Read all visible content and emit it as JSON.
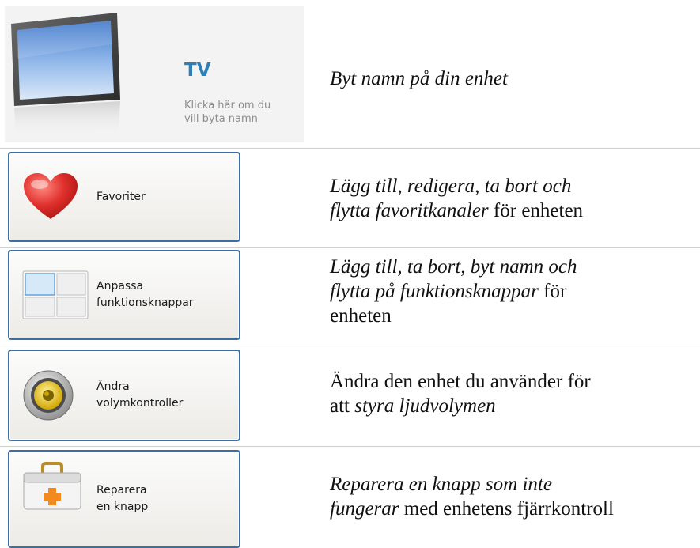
{
  "device": {
    "name": "TV",
    "hint_line1": "Klicka här om du",
    "hint_line2": "vill byta namn",
    "description": "Byt namn på din enhet"
  },
  "buttons": [
    {
      "icon": "heart-icon",
      "label_lines": [
        "Favoriter"
      ],
      "desc_italic_1": "Lägg till, redigera, ta bort och",
      "desc_italic_2": "flytta favoritkanaler",
      "desc_plain_2": " för enheten"
    },
    {
      "icon": "button-grid-icon",
      "label_lines": [
        "Anpassa",
        "funktionsknappar"
      ],
      "desc_italic_1": "Lägg till, ta bort, byt namn och",
      "desc_italic_2": "flytta på funktionsknappar",
      "desc_plain_2": " för",
      "desc_plain_3": "enheten"
    },
    {
      "icon": "speaker-icon",
      "label_lines": [
        "Ändra",
        "volymkontroller"
      ],
      "desc_plain_1": "Ändra den enhet du använder för",
      "desc_plain_2a": "att ",
      "desc_italic_2": "styra ljudvolymen"
    },
    {
      "icon": "first-aid-kit-icon",
      "label_lines": [
        "Reparera",
        "en knapp"
      ],
      "desc_italic_1": "Reparera en knapp som inte",
      "desc_italic_2": "fungerar",
      "desc_plain_2": " med enhetens fjärrkontroll"
    }
  ],
  "colors": {
    "accent_title": "#2d7fb8",
    "button_border": "#3a6ea5",
    "heart": "#e0312d"
  }
}
